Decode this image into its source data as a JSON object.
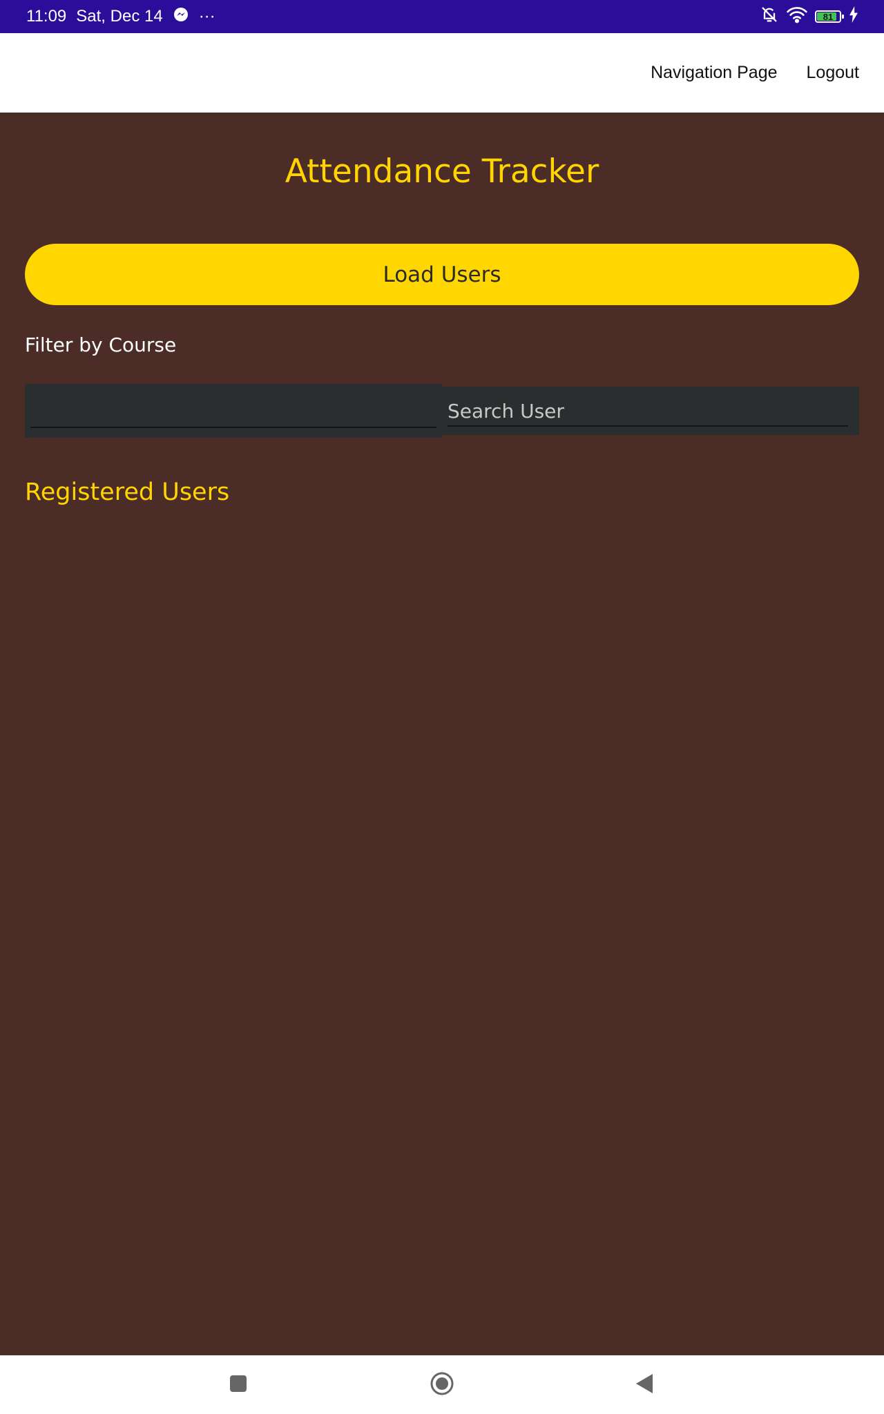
{
  "status_bar": {
    "time": "11:09",
    "date": "Sat, Dec 14",
    "more": "···",
    "battery_level": "81",
    "icons": [
      "messenger-icon",
      "bell-off-icon",
      "wifi-icon",
      "battery-icon",
      "charging-icon"
    ]
  },
  "app_bar": {
    "nav_link": "Navigation Page",
    "logout_link": "Logout"
  },
  "main": {
    "title": "Attendance Tracker",
    "load_button": "Load Users",
    "filter_label": "Filter by Course",
    "course_select_value": "",
    "search_placeholder": "Search User",
    "search_value": "",
    "registered_heading": "Registered Users"
  },
  "nav_bar": {
    "buttons": [
      "recents-icon",
      "home-icon",
      "back-icon"
    ]
  },
  "colors": {
    "status_bar": "#2a0d99",
    "background": "#4b2c27",
    "accent_yellow": "#ffd600",
    "input_bg": "#2b2e2f"
  }
}
